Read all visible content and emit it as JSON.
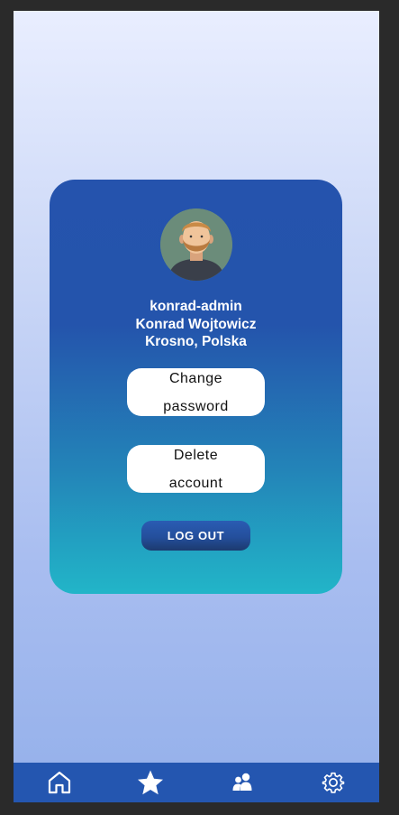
{
  "profile": {
    "username": "konrad-admin",
    "full_name": "Konrad Wojtowicz",
    "location": "Krosno, Polska"
  },
  "actions": {
    "change_password_label": "Change password",
    "delete_account_label": "Delete account",
    "logout_label": "LOG OUT"
  },
  "navbar": {
    "items": [
      {
        "icon": "home-icon"
      },
      {
        "icon": "star-icon"
      },
      {
        "icon": "people-icon"
      },
      {
        "icon": "gear-icon"
      }
    ]
  },
  "colors": {
    "card_top": "#2553ad",
    "card_bottom": "#22b5c8",
    "navbar": "#2456b0",
    "background_top": "#e9eeff",
    "background_bottom": "#94b0ea"
  }
}
